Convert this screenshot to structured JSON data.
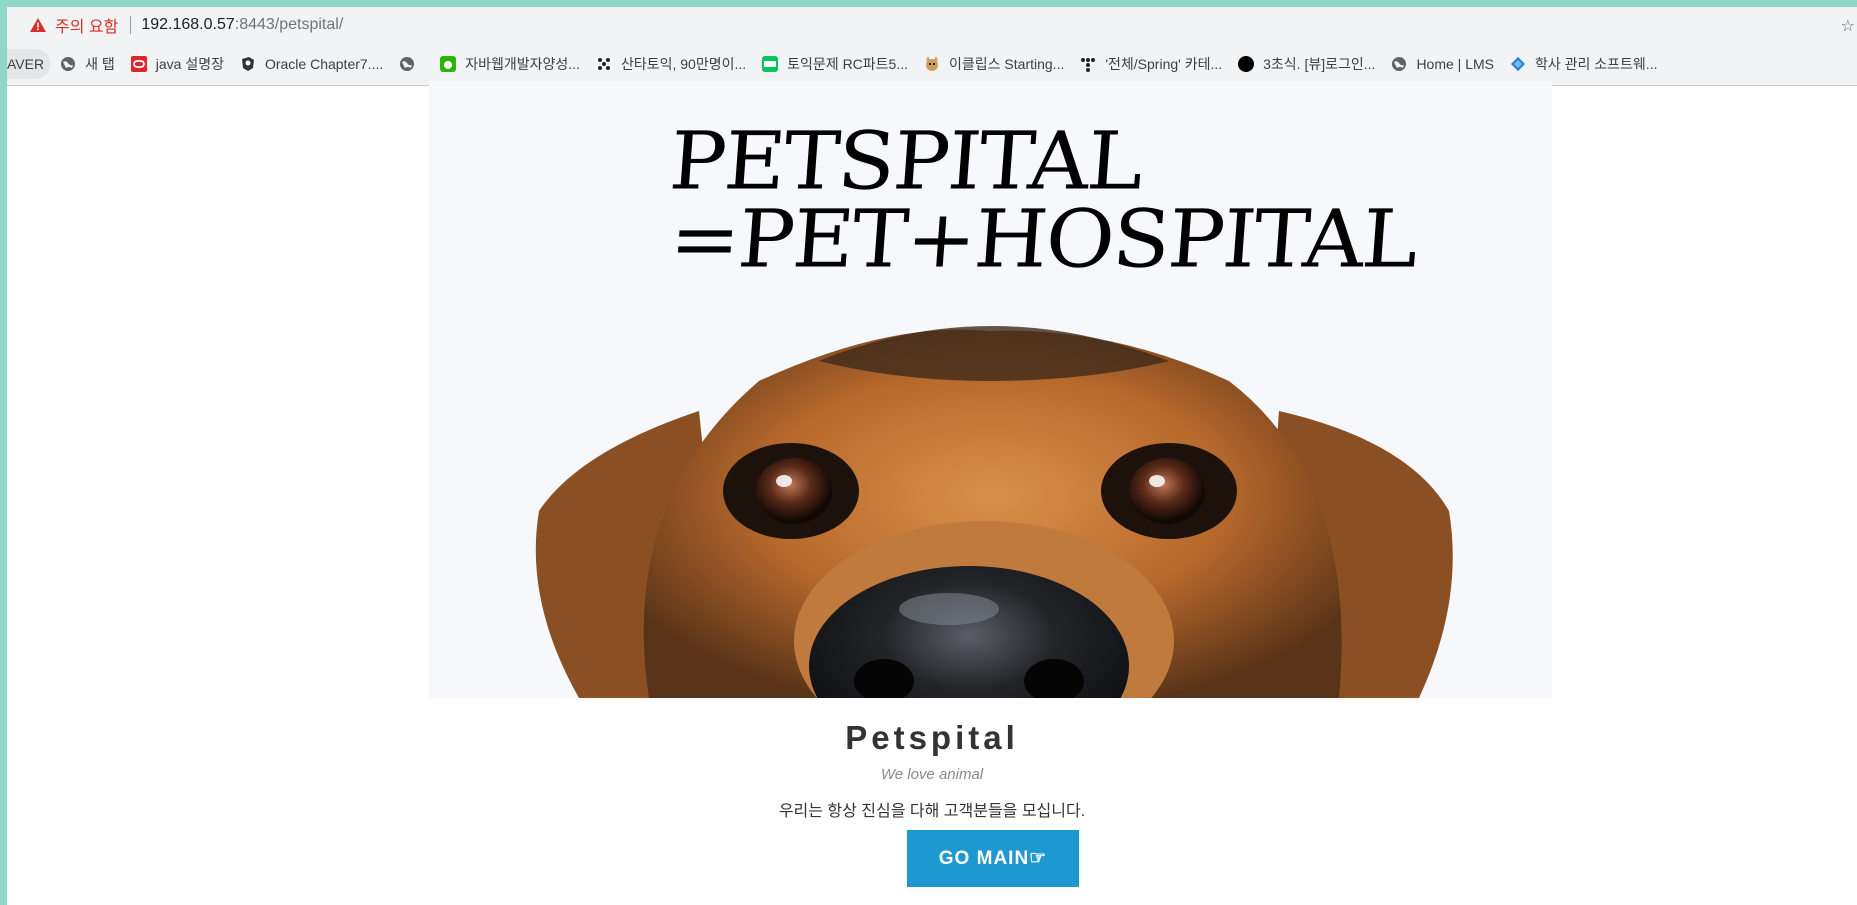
{
  "address_bar": {
    "security_label": "주의 요함",
    "url_host": "192.168.0.57",
    "url_rest": ":8443/petspital/"
  },
  "bookmarks": [
    {
      "label": "AVER",
      "icon": "naver-icon"
    },
    {
      "label": "새 탭",
      "icon": "globe-icon"
    },
    {
      "label": "java 설명장",
      "icon": "oracle-icon"
    },
    {
      "label": "Oracle Chapter7....",
      "icon": "github-icon"
    },
    {
      "label": "",
      "icon": "globe-icon"
    },
    {
      "label": "자바웹개발자양성...",
      "icon": "green-app-icon"
    },
    {
      "label": "산타토익, 90만명이...",
      "icon": "dots-icon"
    },
    {
      "label": "토익문제 RC파트5...",
      "icon": "blog-icon"
    },
    {
      "label": "이클립스 Starting...",
      "icon": "cat-icon"
    },
    {
      "label": "'전체/Spring' 카테...",
      "icon": "tistory-icon"
    },
    {
      "label": "3초식. [뷰]로그인...",
      "icon": "black-circle-icon"
    },
    {
      "label": "Home | LMS",
      "icon": "globe-icon"
    },
    {
      "label": "학사 관리 소프트웨...",
      "icon": "diamond-icon"
    }
  ],
  "hero": {
    "line1": "PETSPITAL",
    "line2": "=PET+HOSPITAL"
  },
  "main": {
    "title": "Petspital",
    "subtitle": "We love animal",
    "description": "우리는 항상 진심을 다해 고객분들을 모십니다.",
    "button_label": "GO MAIN☞"
  },
  "colors": {
    "accent": "#1d98d0",
    "warning": "#d93025",
    "frame": "#8fd8c8"
  }
}
